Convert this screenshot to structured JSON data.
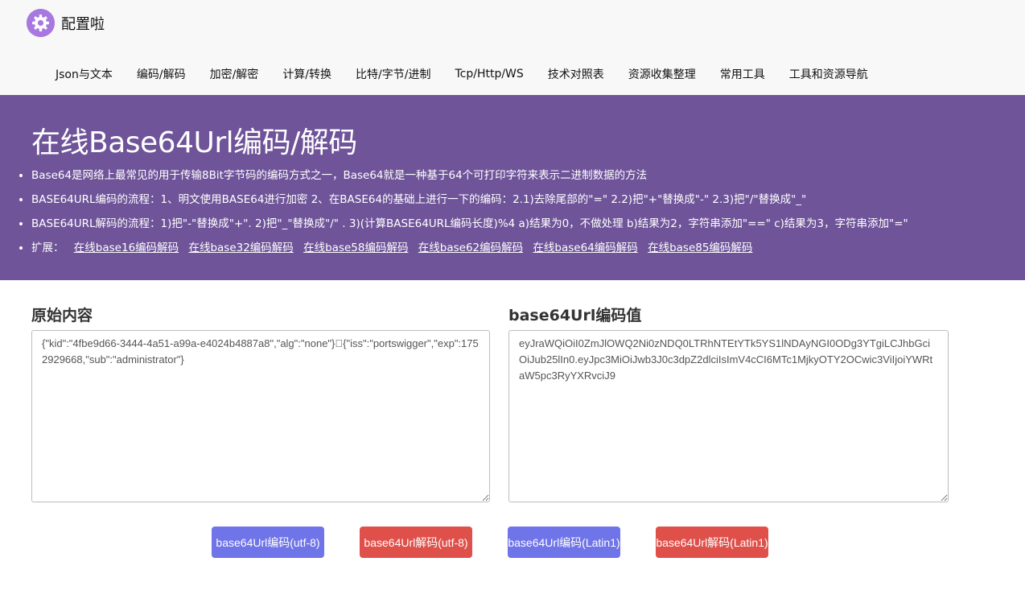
{
  "brand": {
    "name": "配置啦",
    "accent": "#a878e0"
  },
  "nav": [
    "Json与文本",
    "编码/解码",
    "加密/解密",
    "计算/转换",
    "比特/字节/进制",
    "Tcp/Http/WS",
    "技术对照表",
    "资源收集整理",
    "常用工具",
    "工具和资源导航"
  ],
  "hero": {
    "title": "在线Base64Url编码/解码",
    "bullets": [
      "Base64是网络上最常见的用于传输8Bit字节码的编码方式之一，Base64就是一种基于64个可打印字符来表示二进制数据的方法",
      "BASE64URL编码的流程：1、明文使用BASE64进行加密 2、在BASE64的基础上进行一下的编码：2.1)去除尾部的\"=\" 2.2)把\"+\"替换成\"-\" 2.3)把\"/\"替换成\"_\"",
      "BASE64URL解码的流程：1)把\"-\"替换成\"+\". 2)把\"_\"替换成\"/\" . 3)(计算BASE64URL编码长度)%4 a)结果为0，不做处理 b)结果为2，字符串添加\"==\" c)结果为3，字符串添加\"=\""
    ],
    "ext_label": "扩展：",
    "ext_links": [
      "在线base16编码解码",
      "在线base32编码解码",
      "在线base58编码解码",
      "在线base62编码解码",
      "在线base64编码解码",
      "在线base85编码解码"
    ],
    "bg_color": "#6f5499"
  },
  "left_panel": {
    "title": "原始内容",
    "value": "{\"kid\":\"4fbe9d66-3444-4a51-a99a-e4024b4887a8\",\"alg\":\"none\"}\u0000{\"iss\":\"portswigger\",\"exp\":1752929668,\"sub\":\"administrator\"}"
  },
  "right_panel": {
    "title": "base64Url编码值",
    "value": "eyJraWQiOiI0ZmJlOWQ2Ni0zNDQ0LTRhNTEtYTk5YS1lNDAyNGI0ODg3YTgiLCJhbGciOiJub25lIn0.eyJpc3MiOiJwb3J0c3dpZ2dlciIsImV4cCI6MTc1MjkyOTY2OCwic3ViIjoiYWRtaW5pc3RyYXRvciJ9"
  },
  "buttons": {
    "encode_utf8": "base64Url编码(utf-8)",
    "decode_utf8": "base64Url解码(utf-8)",
    "encode_latin1": "base64Url编码(Latin1)",
    "decode_latin1": "base64Url解码(Latin1)",
    "blue": "#6f74e8",
    "red": "#e0504a"
  }
}
